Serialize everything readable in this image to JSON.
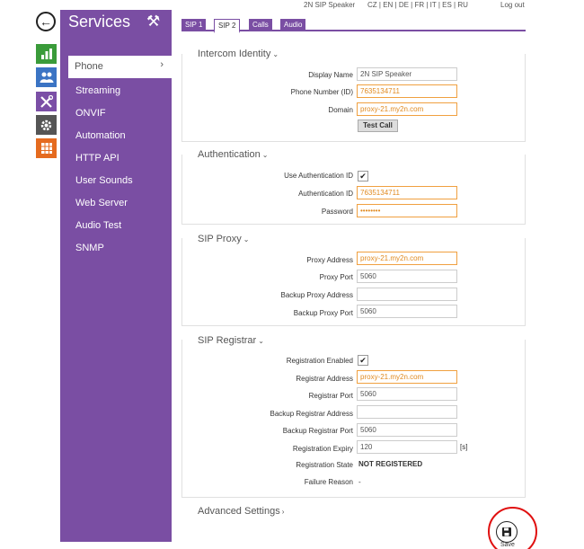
{
  "topbar": {
    "device_name": "2N SIP Speaker",
    "languages": "CZ | EN | DE | FR | IT | ES | RU",
    "logout": "Log out"
  },
  "nav_icons": [
    "back-arrow-icon",
    "status-chart-icon",
    "directory-users-icon",
    "services-tools-icon",
    "hardware-gear-icon",
    "system-grid-icon"
  ],
  "sidebar": {
    "title": "Services",
    "active_item": "Phone",
    "items": [
      "Streaming",
      "ONVIF",
      "Automation",
      "HTTP API",
      "User Sounds",
      "Web Server",
      "Audio Test",
      "SNMP"
    ]
  },
  "tabs": [
    "SIP 1",
    "SIP 2",
    "Calls",
    "Audio"
  ],
  "active_tab": "SIP 2",
  "intercom": {
    "title": "Intercom Identity",
    "display_name_label": "Display Name",
    "display_name": "2N SIP Speaker",
    "phone_label": "Phone Number (ID)",
    "phone": "7635134711",
    "domain_label": "Domain",
    "domain": "proxy-21.my2n.com",
    "test_call": "Test Call"
  },
  "auth": {
    "title": "Authentication",
    "use_id_label": "Use Authentication ID",
    "use_id_checked": true,
    "auth_id_label": "Authentication ID",
    "auth_id": "7635134711",
    "password_label": "Password",
    "password": "••••••••"
  },
  "proxy": {
    "title": "SIP Proxy",
    "address_label": "Proxy Address",
    "address": "proxy-21.my2n.com",
    "port_label": "Proxy Port",
    "port": "5060",
    "backup_address_label": "Backup Proxy Address",
    "backup_address": "",
    "backup_port_label": "Backup Proxy Port",
    "backup_port": "5060"
  },
  "registrar": {
    "title": "SIP Registrar",
    "enabled_label": "Registration Enabled",
    "enabled_checked": true,
    "address_label": "Registrar Address",
    "address": "proxy-21.my2n.com",
    "port_label": "Registrar Port",
    "port": "5060",
    "backup_address_label": "Backup Registrar Address",
    "backup_address": "",
    "backup_port_label": "Backup Registrar Port",
    "backup_port": "5060",
    "expiry_label": "Registration Expiry",
    "expiry": "120",
    "expiry_unit": "[s]",
    "state_label": "Registration State",
    "state": "NOT REGISTERED",
    "failure_label": "Failure Reason",
    "failure": "-"
  },
  "advanced": {
    "title": "Advanced Settings"
  },
  "save_label": "Save",
  "colors": {
    "accent": "#7a4ea3",
    "highlight_field": "#f0a040",
    "annotation": "#e01010"
  }
}
